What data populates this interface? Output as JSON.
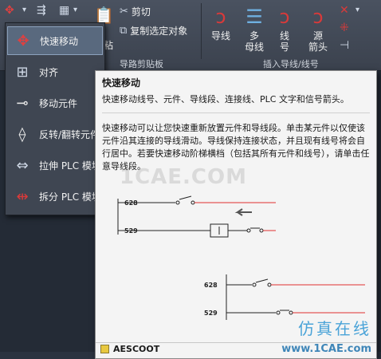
{
  "ribbon": {
    "cut_label": "剪切",
    "copy_selected_label": "复制选定对象",
    "paste_label": "粘",
    "big_buttons": [
      {
        "label_1": "导线",
        "label_2": ""
      },
      {
        "label_1": "多",
        "label_2": "母线"
      },
      {
        "label_1": "线",
        "label_2": "号"
      },
      {
        "label_1": "源",
        "label_2": "箭头"
      }
    ],
    "panel_label_1": "导路剪贴板",
    "panel_label_2": "插入导线/线号"
  },
  "dropdown": {
    "items": [
      {
        "label": "快速移动",
        "icon": "quick-move-icon"
      },
      {
        "label": "对齐",
        "icon": "align-icon"
      },
      {
        "label": "移动元件",
        "icon": "move-component-icon"
      },
      {
        "label": "反转/翻转元件",
        "icon": "reverse-flip-icon"
      },
      {
        "label": "拉伸 PLC 模块",
        "icon": "stretch-plc-icon"
      },
      {
        "label": "拆分 PLC 模块",
        "icon": "split-plc-icon"
      }
    ]
  },
  "tooltip": {
    "title": "快速移动",
    "summary": "快速移动线号、元件、导线段、连接线、PLC 文字和信号箭头。",
    "description": "快速移动可以让您快速重新放置元件和导线段。单击某元件以仅使该元件沿其连接的导线滑动。导线保持连接状态，并且现有线号将会自行居中。若要快速移动阶梯横档（包括其所有元件和线号），请单击任意导线段。",
    "diagram": {
      "before_labels": [
        "628",
        "529"
      ],
      "after_labels": [
        "628",
        "529"
      ]
    },
    "footer": "AESCOOT"
  },
  "watermark": {
    "site_text": "1CAE.COM",
    "brand": "仿真在线",
    "url": "www.1CAE.com"
  },
  "colors": {
    "accent_red": "#d83a3a",
    "wire_red": "#e03030",
    "highlight": "#59697e"
  }
}
